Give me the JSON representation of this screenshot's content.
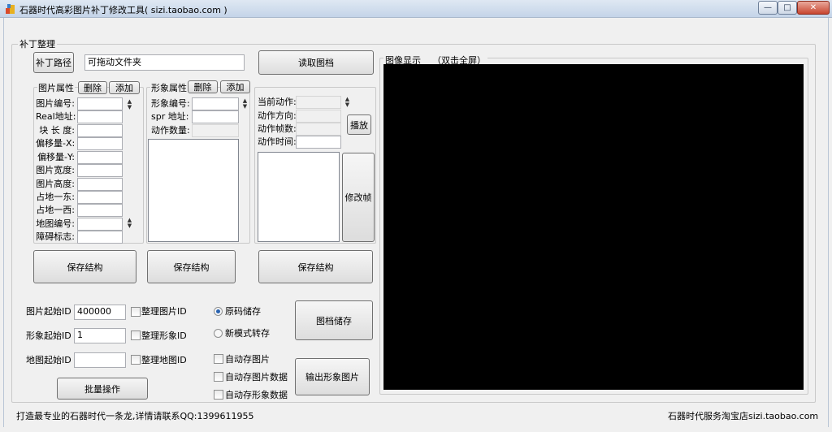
{
  "window": {
    "title": "石器时代高彩图片补丁修改工具( sizi.taobao.com )",
    "min_icon": "minimize-icon",
    "max_icon": "maximize-icon",
    "close_icon": "close-icon",
    "min_glyph": "—",
    "max_glyph": "□",
    "close_glyph": "✕"
  },
  "patch": {
    "group_label": "补丁整理",
    "path_button": "补丁路径",
    "path_value": "可拖动文件夹",
    "read_button": "读取图档"
  },
  "image_props": {
    "label": "图片属性",
    "delete": "删除",
    "add": "添加",
    "fields": [
      "图片编号:",
      "Real地址:",
      "块 长 度:",
      "偏移量-X:",
      "偏移量-Y:",
      "图片宽度:",
      "图片高度:",
      "占地一东:",
      "占地一西:",
      "地图编号:",
      "障碍标志:"
    ],
    "save": "保存结构"
  },
  "shape_props": {
    "label": "形象属性",
    "delete": "删除",
    "add": "添加",
    "fields": [
      "形象编号:",
      "spr  地址:",
      "动作数量:"
    ],
    "save": "保存结构"
  },
  "action": {
    "fields": [
      "当前动作:",
      "动作方向:",
      "动作帧数:",
      "动作时间:"
    ],
    "play": "播放",
    "edit_frame": "修改帧",
    "save": "保存结构"
  },
  "settings": {
    "image_start_label": "图片起始ID",
    "image_start_value": "400000",
    "shape_start_label": "形象起始ID",
    "shape_start_value": "1",
    "map_start_label": "地图起始ID",
    "map_start_value": "",
    "chk_image": "整理图片ID",
    "chk_shape": "整理形象ID",
    "chk_map": "整理地图ID",
    "batch": "批量操作",
    "radio_original": "原码储存",
    "radio_new": "新模式转存",
    "auto_image": "自动存图片",
    "auto_image_data": "自动存图片数据",
    "auto_shape_data": "自动存形象数据",
    "save_archive": "图档储存",
    "export_shape": "输出形象图片"
  },
  "display": {
    "label": "图像显示",
    "hint": "（双击全屏）",
    "background": "#000000"
  },
  "status": {
    "left": "打造最专业的石器时代一条龙,详情请联系QQ:1399611955",
    "right": "石器时代服务淘宝店sizi.taobao.com"
  }
}
